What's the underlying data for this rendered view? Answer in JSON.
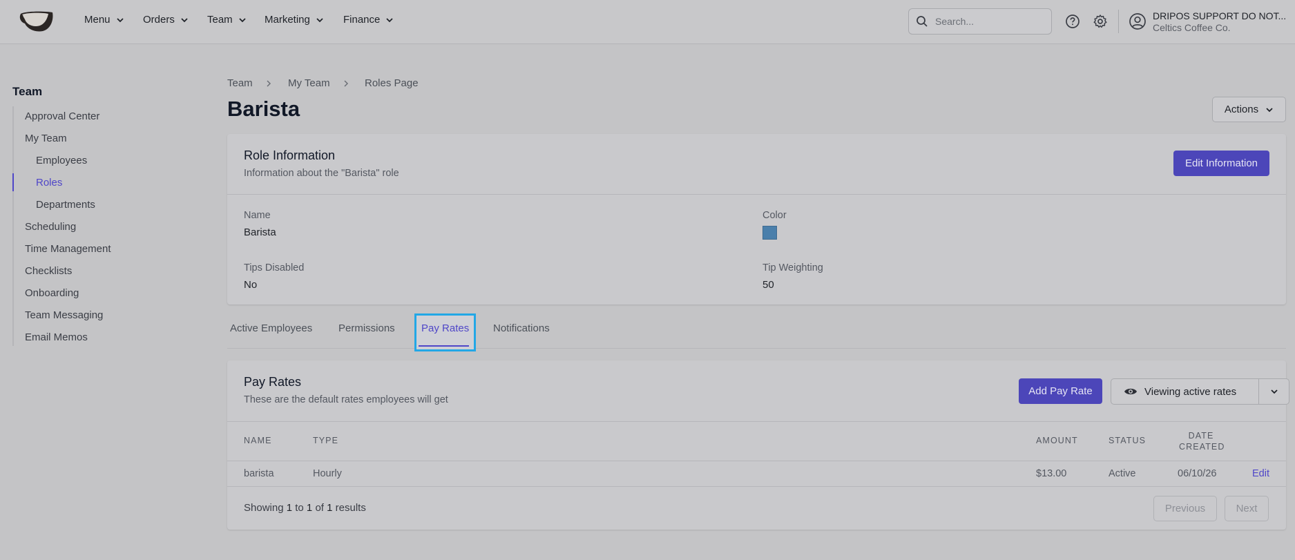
{
  "nav": {
    "items": [
      "Menu",
      "Orders",
      "Team",
      "Marketing",
      "Finance"
    ],
    "search_placeholder": "Search...",
    "user_name": "DRIPOS SUPPORT DO NOT...",
    "user_org": "Celtics Coffee Co."
  },
  "sidebar": {
    "title": "Team",
    "items": [
      "Approval Center",
      "My Team",
      "Employees",
      "Roles",
      "Departments",
      "Scheduling",
      "Time Management",
      "Checklists",
      "Onboarding",
      "Team Messaging",
      "Email Memos"
    ],
    "active": "Roles"
  },
  "breadcrumb": [
    "Team",
    "My Team",
    "Roles Page"
  ],
  "page": {
    "title": "Barista",
    "actions_label": "Actions"
  },
  "role_info": {
    "title": "Role Information",
    "subtitle": "Information about the \"Barista\" role",
    "edit_label": "Edit Information",
    "fields": {
      "name_label": "Name",
      "name_value": "Barista",
      "color_label": "Color",
      "color_value": "#4a7fab",
      "tips_label": "Tips Disabled",
      "tips_value": "No",
      "weighting_label": "Tip Weighting",
      "weighting_value": "50"
    }
  },
  "tabs": [
    "Active Employees",
    "Permissions",
    "Pay Rates",
    "Notifications"
  ],
  "active_tab": "Pay Rates",
  "pay_rates": {
    "title": "Pay Rates",
    "subtitle": "These are the default rates employees will get",
    "add_label": "Add Pay Rate",
    "viewing_label": "Viewing active rates",
    "columns": {
      "name": "Name",
      "type": "Type",
      "amount": "Amount",
      "status": "Status",
      "date_line1": "Date",
      "date_line2": "Created"
    },
    "rows": [
      {
        "name": "barista",
        "type": "Hourly",
        "amount": "$13.00",
        "status": "Active",
        "date": "06/10/26",
        "action": "Edit"
      }
    ],
    "pagination": {
      "showing_prefix": "Showing",
      "from": "1",
      "to_word": "to",
      "to": "1",
      "of_word": "of",
      "total": "1",
      "results_word": "results",
      "previous_label": "Previous",
      "next_label": "Next"
    }
  },
  "colors": {
    "accent": "#4c46b9",
    "focus_ring": "#22a7e6"
  }
}
